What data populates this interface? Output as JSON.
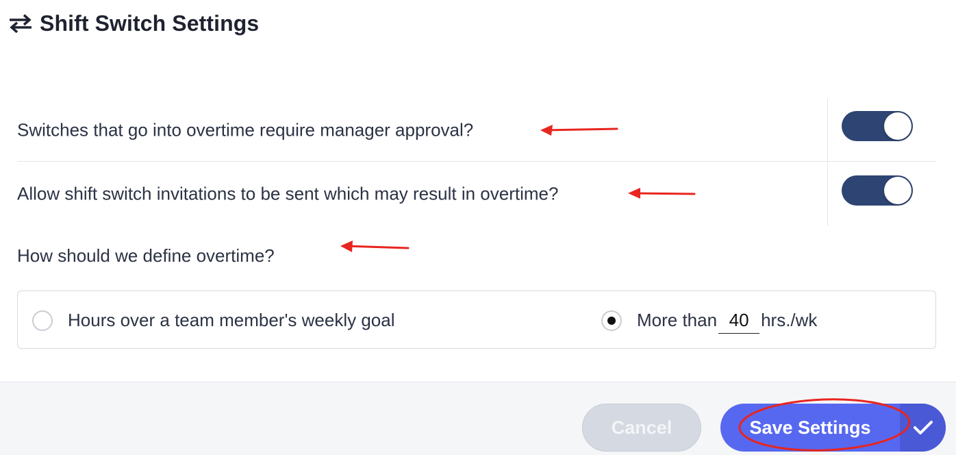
{
  "header": {
    "title": "Shift Switch Settings",
    "icon": "swap-arrows-icon"
  },
  "settings": {
    "overtime_approval": {
      "label": "Switches that go into overtime require manager approval?",
      "enabled": true
    },
    "overtime_invitations": {
      "label": "Allow shift switch invitations to be sent which may result in overtime?",
      "enabled": true
    }
  },
  "overtime_definition": {
    "question": "How should we define overtime?",
    "options": [
      {
        "label": "Hours over a team member's weekly goal",
        "selected": false
      },
      {
        "label_prefix": "More than",
        "value": "40",
        "label_suffix": "hrs./wk",
        "selected": true
      }
    ]
  },
  "footer": {
    "cancel_label": "Cancel",
    "save_label": "Save Settings"
  },
  "colors": {
    "toggle_on": "#2e4473",
    "save_button": "#5768f0",
    "annotation": "#e8251f"
  }
}
